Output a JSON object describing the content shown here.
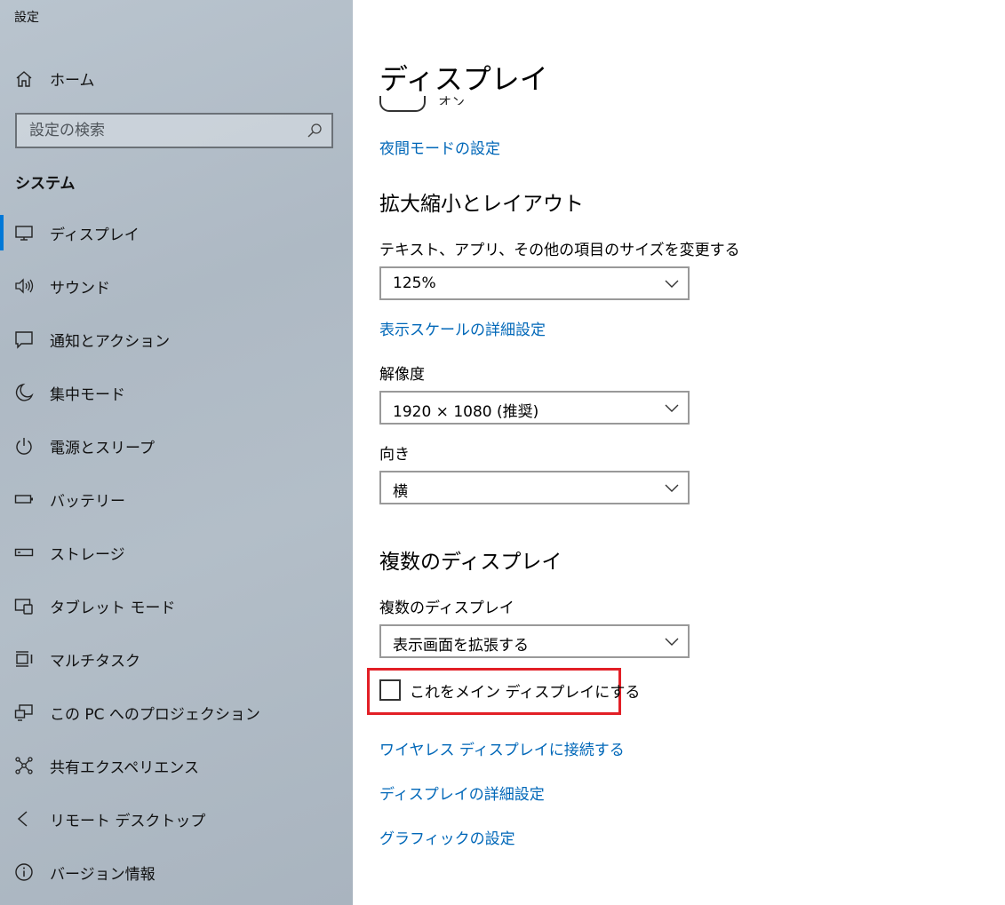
{
  "window": {
    "title": "設定"
  },
  "sidebar": {
    "home_label": "ホーム",
    "search_placeholder": "設定の検索",
    "section_label": "システム",
    "items": [
      {
        "label": "ディスプレイ",
        "icon": "monitor-icon",
        "active": true
      },
      {
        "label": "サウンド",
        "icon": "speaker-icon"
      },
      {
        "label": "通知とアクション",
        "icon": "notification-icon"
      },
      {
        "label": "集中モード",
        "icon": "moon-icon"
      },
      {
        "label": "電源とスリープ",
        "icon": "power-icon"
      },
      {
        "label": "バッテリー",
        "icon": "battery-icon"
      },
      {
        "label": "ストレージ",
        "icon": "storage-icon"
      },
      {
        "label": "タブレット モード",
        "icon": "tablet-mode-icon"
      },
      {
        "label": "マルチタスク",
        "icon": "multitask-icon"
      },
      {
        "label": "この PC へのプロジェクション",
        "icon": "projection-icon"
      },
      {
        "label": "共有エクスペリエンス",
        "icon": "share-icon"
      },
      {
        "label": "リモート デスクトップ",
        "icon": "remote-desktop-icon"
      },
      {
        "label": "バージョン情報",
        "icon": "info-icon"
      }
    ]
  },
  "main": {
    "page_title": "ディスプレイ",
    "night_light_state": "オン",
    "night_light_settings_link": "夜間モードの設定",
    "scale_section": {
      "heading": "拡大縮小とレイアウト",
      "size_label": "テキスト、アプリ、その他の項目のサイズを変更する",
      "size_value": "125%",
      "advanced_scale_link": "表示スケールの詳細設定",
      "resolution_label": "解像度",
      "resolution_value": "1920 × 1080 (推奨)",
      "orientation_label": "向き",
      "orientation_value": "横"
    },
    "multi_section": {
      "heading": "複数のディスプレイ",
      "multi_label": "複数のディスプレイ",
      "multi_value": "表示画面を拡張する",
      "main_display_checkbox": "これをメイン ディスプレイにする",
      "wireless_link": "ワイヤレス ディスプレイに接続する",
      "advanced_display_link": "ディスプレイの詳細設定",
      "graphics_link": "グラフィックの設定"
    }
  },
  "colors": {
    "accent": "#0078d7",
    "link": "#0067b8",
    "highlight": "#e21f26"
  }
}
